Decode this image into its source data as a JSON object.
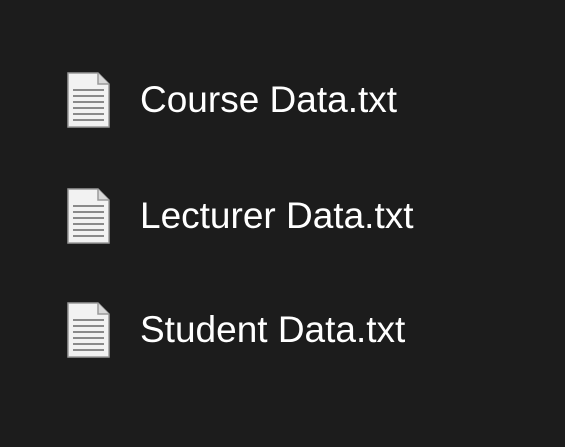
{
  "files": [
    {
      "name": "Course Data.txt",
      "icon": "text-file-icon"
    },
    {
      "name": "Lecturer Data.txt",
      "icon": "text-file-icon"
    },
    {
      "name": "Student Data.txt",
      "icon": "text-file-icon"
    }
  ],
  "colors": {
    "background": "#1c1c1c",
    "text": "#ffffff",
    "icon_page": "#f2f2f2",
    "icon_lines": "#8a8a8a"
  }
}
